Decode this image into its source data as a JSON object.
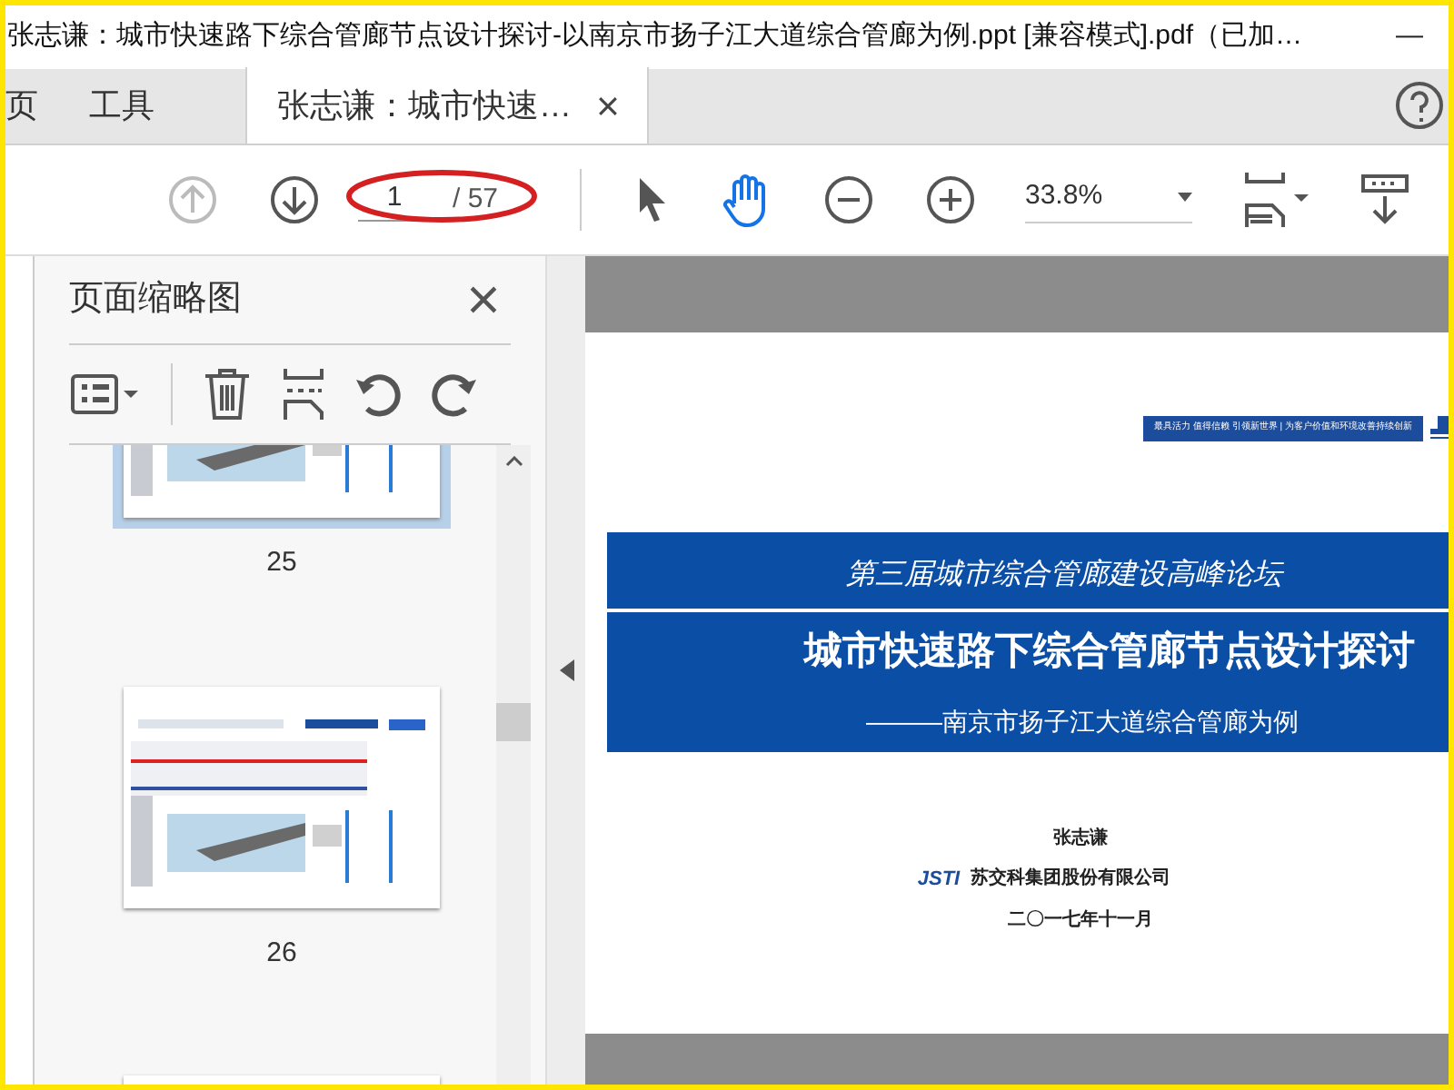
{
  "window": {
    "title": "张志谦：城市快速路下综合管廊节点设计探讨-以南京市扬子江大道综合管廊为例.ppt [兼容模式].pdf（已加…",
    "controls": [
      "—"
    ]
  },
  "nav_tabs": [
    {
      "label": "页",
      "selected": false
    },
    {
      "label": "工具",
      "selected": false
    },
    {
      "label": "张志谦：城市快速…",
      "selected": true
    }
  ],
  "toolbar": {
    "page_current": "1",
    "page_total": "/ 57",
    "zoom": "33.8%",
    "hand_tool": true
  },
  "thumbnails_panel": {
    "title": "页面缩略图",
    "pages": [
      {
        "label": "25",
        "selected": true
      },
      {
        "label": "26",
        "selected": false
      },
      {
        "selected": false
      }
    ]
  },
  "slide": {
    "tagline": "最具活力 值得信赖 引领新世界 | 为客户价值和环境改善持续创新",
    "subtitle": "第三届城市综合管廊建设高峰论坛",
    "title": "城市快速路下综合管廊节点设计探讨",
    "case": "———南京市扬子江大道综合管廊为例",
    "author": "张志谦",
    "company": "苏交科集团股份有限公司",
    "date": "二〇一七年十一月",
    "logo": "JSTI"
  }
}
